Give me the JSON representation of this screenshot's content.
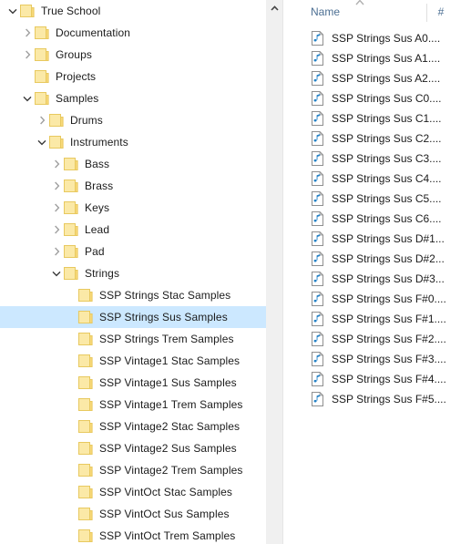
{
  "nav_pane": {
    "scrollbar": {
      "up_arrow_icon": "chevron-up-icon"
    },
    "tree_items": [
      {
        "label": "True School",
        "depth": 0,
        "state": "expanded",
        "selected": false
      },
      {
        "label": "Documentation",
        "depth": 1,
        "state": "collapsed",
        "selected": false
      },
      {
        "label": "Groups",
        "depth": 1,
        "state": "collapsed",
        "selected": false
      },
      {
        "label": "Projects",
        "depth": 1,
        "state": "leaf",
        "selected": false
      },
      {
        "label": "Samples",
        "depth": 1,
        "state": "expanded",
        "selected": false
      },
      {
        "label": "Drums",
        "depth": 2,
        "state": "collapsed",
        "selected": false
      },
      {
        "label": "Instruments",
        "depth": 2,
        "state": "expanded",
        "selected": false
      },
      {
        "label": "Bass",
        "depth": 3,
        "state": "collapsed",
        "selected": false
      },
      {
        "label": "Brass",
        "depth": 3,
        "state": "collapsed",
        "selected": false
      },
      {
        "label": "Keys",
        "depth": 3,
        "state": "collapsed",
        "selected": false
      },
      {
        "label": "Lead",
        "depth": 3,
        "state": "collapsed",
        "selected": false
      },
      {
        "label": "Pad",
        "depth": 3,
        "state": "collapsed",
        "selected": false
      },
      {
        "label": "Strings",
        "depth": 3,
        "state": "expanded",
        "selected": false
      },
      {
        "label": "SSP Strings Stac Samples",
        "depth": 4,
        "state": "leaf",
        "selected": false
      },
      {
        "label": "SSP Strings Sus Samples",
        "depth": 4,
        "state": "leaf",
        "selected": true
      },
      {
        "label": "SSP Strings Trem Samples",
        "depth": 4,
        "state": "leaf",
        "selected": false
      },
      {
        "label": "SSP Vintage1 Stac Samples",
        "depth": 4,
        "state": "leaf",
        "selected": false
      },
      {
        "label": "SSP Vintage1 Sus Samples",
        "depth": 4,
        "state": "leaf",
        "selected": false
      },
      {
        "label": "SSP Vintage1 Trem Samples",
        "depth": 4,
        "state": "leaf",
        "selected": false
      },
      {
        "label": "SSP Vintage2 Stac Samples",
        "depth": 4,
        "state": "leaf",
        "selected": false
      },
      {
        "label": "SSP Vintage2 Sus Samples",
        "depth": 4,
        "state": "leaf",
        "selected": false
      },
      {
        "label": "SSP Vintage2 Trem Samples",
        "depth": 4,
        "state": "leaf",
        "selected": false
      },
      {
        "label": "SSP VintOct Stac Samples",
        "depth": 4,
        "state": "leaf",
        "selected": false
      },
      {
        "label": "SSP VintOct Sus Samples",
        "depth": 4,
        "state": "leaf",
        "selected": false
      },
      {
        "label": "SSP VintOct Trem Samples",
        "depth": 4,
        "state": "leaf",
        "selected": false
      }
    ]
  },
  "list_pane": {
    "columns": {
      "name": "Name",
      "number": "#"
    },
    "files": [
      {
        "name": "SSP Strings Sus A0....",
        "icon": "audio-file-icon"
      },
      {
        "name": "SSP Strings Sus A1....",
        "icon": "audio-file-icon"
      },
      {
        "name": "SSP Strings Sus A2....",
        "icon": "audio-file-icon"
      },
      {
        "name": "SSP Strings Sus C0....",
        "icon": "audio-file-icon"
      },
      {
        "name": "SSP Strings Sus C1....",
        "icon": "audio-file-icon"
      },
      {
        "name": "SSP Strings Sus C2....",
        "icon": "audio-file-icon"
      },
      {
        "name": "SSP Strings Sus C3....",
        "icon": "audio-file-icon"
      },
      {
        "name": "SSP Strings Sus C4....",
        "icon": "audio-file-icon"
      },
      {
        "name": "SSP Strings Sus C5....",
        "icon": "audio-file-icon"
      },
      {
        "name": "SSP Strings Sus C6....",
        "icon": "audio-file-icon"
      },
      {
        "name": "SSP Strings Sus D#1...",
        "icon": "audio-file-icon"
      },
      {
        "name": "SSP Strings Sus D#2...",
        "icon": "audio-file-icon"
      },
      {
        "name": "SSP Strings Sus D#3...",
        "icon": "audio-file-icon"
      },
      {
        "name": "SSP Strings Sus F#0....",
        "icon": "audio-file-icon"
      },
      {
        "name": "SSP Strings Sus F#1....",
        "icon": "audio-file-icon"
      },
      {
        "name": "SSP Strings Sus F#2....",
        "icon": "audio-file-icon"
      },
      {
        "name": "SSP Strings Sus F#3....",
        "icon": "audio-file-icon"
      },
      {
        "name": "SSP Strings Sus F#4....",
        "icon": "audio-file-icon"
      },
      {
        "name": "SSP Strings Sus F#5....",
        "icon": "audio-file-icon"
      }
    ]
  },
  "colors": {
    "selection": "#cce8ff",
    "folder_body": "#fbe9a7",
    "folder_tab": "#f8d97a",
    "header_text": "#4c6f93",
    "note_blue": "#2481c6",
    "scrollbar_track": "#f0f0f0"
  }
}
